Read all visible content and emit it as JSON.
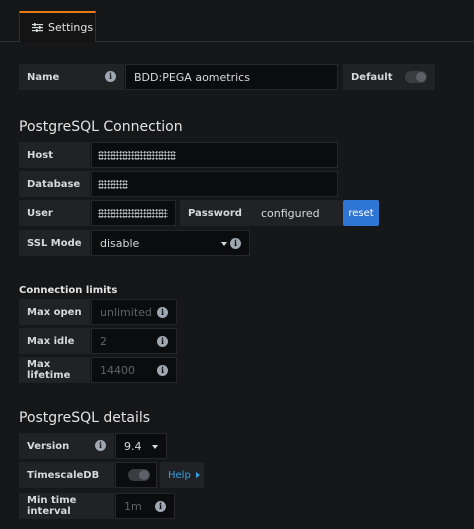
{
  "tabs": [
    {
      "label": "Settings",
      "icon": "sliders-icon",
      "active": true
    }
  ],
  "name_field": {
    "label": "Name",
    "value": "BDD:PEGA aometrics",
    "default_label": "Default",
    "default_on": false
  },
  "connection": {
    "title": "PostgreSQL Connection",
    "host_label": "Host",
    "database_label": "Database",
    "user_label": "User",
    "password_label": "Password",
    "password_value": "configured",
    "reset_label": "reset",
    "ssl_label": "SSL Mode",
    "ssl_value": "disable"
  },
  "limits": {
    "title": "Connection limits",
    "max_open_label": "Max open",
    "max_open_placeholder": "unlimited",
    "max_idle_label": "Max idle",
    "max_idle_placeholder": "2",
    "max_lifetime_label": "Max lifetime",
    "max_lifetime_placeholder": "14400"
  },
  "details": {
    "title": "PostgreSQL details",
    "version_label": "Version",
    "version_value": "9.4",
    "timescale_label": "TimescaleDB",
    "timescale_on": false,
    "help_label": "Help",
    "min_interval_label": "Min time interval",
    "min_interval_placeholder": "1m"
  },
  "colors": {
    "accent": "#eb7b18",
    "primary_button": "#2f75d6",
    "link": "#33a2e5",
    "background": "#161719"
  }
}
